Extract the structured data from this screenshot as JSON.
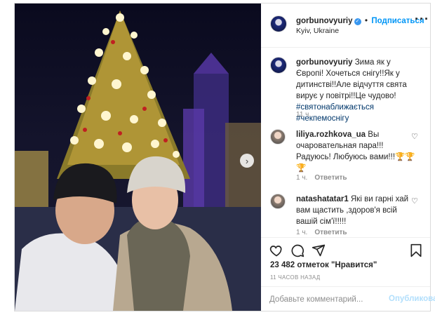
{
  "post": {
    "username": "gorbunovyuriy",
    "verified_mark": "✓",
    "follow_label": "Подписаться",
    "separator": "•",
    "location": "Kyiv, Ukraine",
    "more_icon": "more-horizontal-icon"
  },
  "caption": {
    "username": "gorbunovyuriy",
    "text": "Зима як у Європі! Хочеться снігу!!Як у дитинстві!!Але відчуття свята вирує у повітрі!!Це чудово!",
    "hashtags": "#святонаближається #чекпемоснігу",
    "time": "11 ч."
  },
  "comments": [
    {
      "username": "liliya.rozhkova_ua",
      "text": "Вы очаровательная пара!!! Радуюсь! Любуюсь вами!!!🏆🏆🏆",
      "time": "1 ч.",
      "reply_label": "Ответить"
    },
    {
      "username": "natashatatar1",
      "text": "Які ви гарні хай вам щастить ,здоров'я всій вашій сім'ї!!!!!",
      "time": "1 ч.",
      "reply_label": "Ответить"
    }
  ],
  "actions": {
    "icons": [
      "heart-icon",
      "comment-icon",
      "share-icon",
      "bookmark-icon"
    ],
    "likes_text": "23 482 отметок \"Нравится\"",
    "timestamp": "11 ЧАСОВ НАЗАД"
  },
  "composer": {
    "placeholder": "Добавьте комментарий...",
    "publish_label": "Опубликовать"
  },
  "colors": {
    "link_blue": "#0095f6",
    "publish_disabled": "#b2dffc",
    "hashtag": "#00376b",
    "border": "#dbdbdb"
  }
}
